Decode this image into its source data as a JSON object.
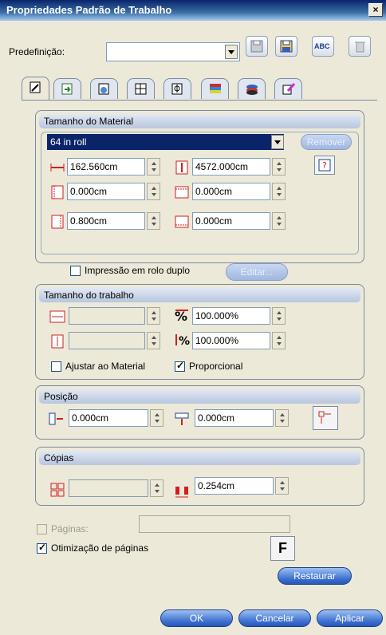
{
  "window": {
    "title": "Propriedades Padrão de Trabalho",
    "close_glyph": "×"
  },
  "preset": {
    "label": "Predefinição:",
    "value": ""
  },
  "toolbar": {
    "abc_label": "ABC"
  },
  "material": {
    "header": "Tamanho do Material",
    "selected": "64 in roll",
    "remove_label": "Remover",
    "width": "162.560cm",
    "length": "4572.000cm",
    "margin_left": "0.000cm",
    "margin_top": "0.000cm",
    "margin_right": "0.800cm",
    "margin_bottom": "0.000cm"
  },
  "double_roll": {
    "label": "Impressão em rolo duplo",
    "checked": false,
    "edit_label": "Editar..."
  },
  "job_size": {
    "header": "Tamanho do trabalho",
    "width": "",
    "height": "",
    "scale_x": "100.000%",
    "scale_y": "100.000%",
    "fit_label": "Ajustar ao Material",
    "fit_checked": false,
    "proportional_label": "Proporcional",
    "proportional_checked": true
  },
  "position": {
    "header": "Posição",
    "x": "0.000cm",
    "y": "0.000cm"
  },
  "copies": {
    "header": "Cópias",
    "count": "",
    "spacing": "0.254cm"
  },
  "pages": {
    "label": "Páginas:",
    "checked": false,
    "value": ""
  },
  "optimization": {
    "label": "Otimização de páginas",
    "checked": true,
    "f_label": "F"
  },
  "buttons": {
    "restore": "Restaurar",
    "ok": "OK",
    "cancel": "Cancelar",
    "apply": "Aplicar"
  }
}
